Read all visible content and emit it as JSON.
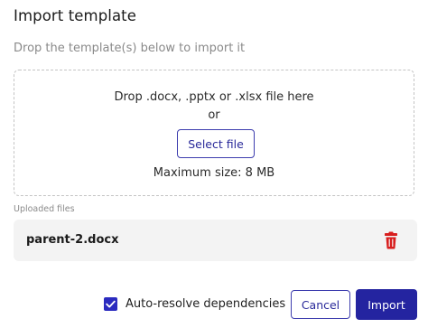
{
  "dialog": {
    "title": "Import template",
    "subtitle": "Drop the template(s) below to import it"
  },
  "dropzone": {
    "instruction": "Drop .docx, .pptx or .xlsx file here",
    "or_text": "or",
    "select_label": "Select file",
    "max_size": "Maximum size: 8 MB"
  },
  "uploaded": {
    "label": "Uploaded files",
    "files": [
      {
        "name": "parent-2.docx",
        "delete_icon": "trash-icon"
      }
    ]
  },
  "footer": {
    "auto_resolve_label": "Auto-resolve dependencies",
    "auto_resolve_checked": true,
    "cancel_label": "Cancel",
    "import_label": "Import"
  },
  "colors": {
    "primary": "#2424a0",
    "delete": "#d81e1e",
    "file_row_bg": "#f3f3f3",
    "muted_text": "#8a8a8a"
  }
}
